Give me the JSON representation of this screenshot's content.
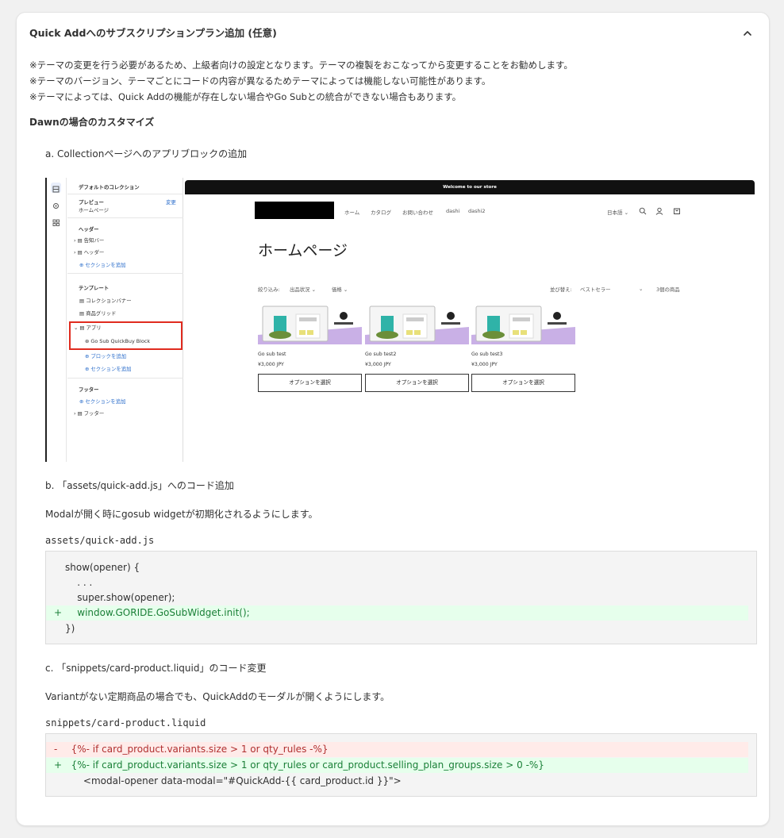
{
  "card": {
    "title": "Quick Addへのサブスクリプションプラン追加 (任意)",
    "notes": [
      "※テーマの変更を行う必要があるため、上級者向けの設定となります。テーマの複製をおこなってから変更することをお勧めします。",
      "※テーマのバージョン、テーマごとにコードの内容が異なるためテーマによっては機能しない可能性があります。",
      "※テーマによっては、Quick Addの機能が存在しない場合やGo Subとの統合ができない場合もあります。"
    ],
    "section_heading": "Dawnの場合のカスタマイズ"
  },
  "step_a": {
    "label": "a. Collectionページへのアプリブロックの追加"
  },
  "screenshot": {
    "sidebar": {
      "collection_title": "デフォルトのコレクション",
      "preview_label": "プレビュー",
      "preview_page": "ホームページ",
      "change_link": "変更",
      "header_group": "ヘッダー",
      "notice_bar": "告知バー",
      "header_item": "ヘッダー",
      "add_section_1": "セクションを追加",
      "template_group": "テンプレート",
      "collection_banner": "コレクションバナー",
      "product_grid": "商品グリッド",
      "app_item": "アプリ",
      "app_block": "Go Sub QuickBuy Block",
      "add_block": "ブロックを追加",
      "add_section_2": "セクションを追加",
      "footer_group": "フッター",
      "add_section_3": "セクションを追加",
      "footer_item": "フッター"
    },
    "preview": {
      "announcement": "Welcome to our store",
      "nav": [
        "ホーム",
        "カタログ",
        "お問い合わせ",
        "dashi",
        "dashi2"
      ],
      "language": "日本語",
      "page_title": "ホームページ",
      "filter_label": "絞り込み:",
      "filter_availability": "出品状況",
      "filter_price": "価格",
      "sort_label": "並び替え:",
      "sort_value": "ベストセラー",
      "product_count": "3個の商品",
      "products": [
        {
          "name": "Go sub test",
          "price": "¥3,000 JPY",
          "button": "オプションを選択"
        },
        {
          "name": "Go sub test2",
          "price": "¥3,000 JPY",
          "button": "オプションを選択"
        },
        {
          "name": "Go sub test3",
          "price": "¥3,000 JPY",
          "button": "オプションを選択"
        }
      ]
    }
  },
  "step_b": {
    "label": "b. 「assets/quick-add.js」へのコード追加",
    "description": "Modalが開く時にgosub widgetが初期化されるようにします。",
    "file": "assets/quick-add.js",
    "code": [
      {
        "type": "ctx",
        "mark": "",
        "text": "show(opener) {"
      },
      {
        "type": "ctx",
        "mark": "",
        "text": "    . . ."
      },
      {
        "type": "ctx",
        "mark": "",
        "text": "    super.show(opener);"
      },
      {
        "type": "add",
        "mark": "+",
        "text": "    window.GORIDE.GoSubWidget.init();"
      },
      {
        "type": "ctx",
        "mark": "",
        "text": "})"
      }
    ]
  },
  "step_c": {
    "label": "c. 「snippets/card-product.liquid」のコード変更",
    "description": "Variantがない定期商品の場合でも、QuickAddのモーダルが開くようにします。",
    "file": "snippets/card-product.liquid",
    "code": [
      {
        "type": "del",
        "mark": "-",
        "text": "  {%- if card_product.variants.size > 1 or qty_rules -%}"
      },
      {
        "type": "add",
        "mark": "+",
        "text": "  {%- if card_product.variants.size > 1 or qty_rules or card_product.selling_plan_groups.size > 0 -%}"
      },
      {
        "type": "ctx",
        "mark": "",
        "text": "      <modal-opener data-modal=\"#QuickAdd-{{ card_product.id }}\">"
      }
    ]
  },
  "colors": {
    "add_bg": "#e6ffec",
    "add_fg": "#1a7f37",
    "del_bg": "#ffebe9",
    "del_fg": "#b03030",
    "highlight_box": "#e02b1f"
  }
}
